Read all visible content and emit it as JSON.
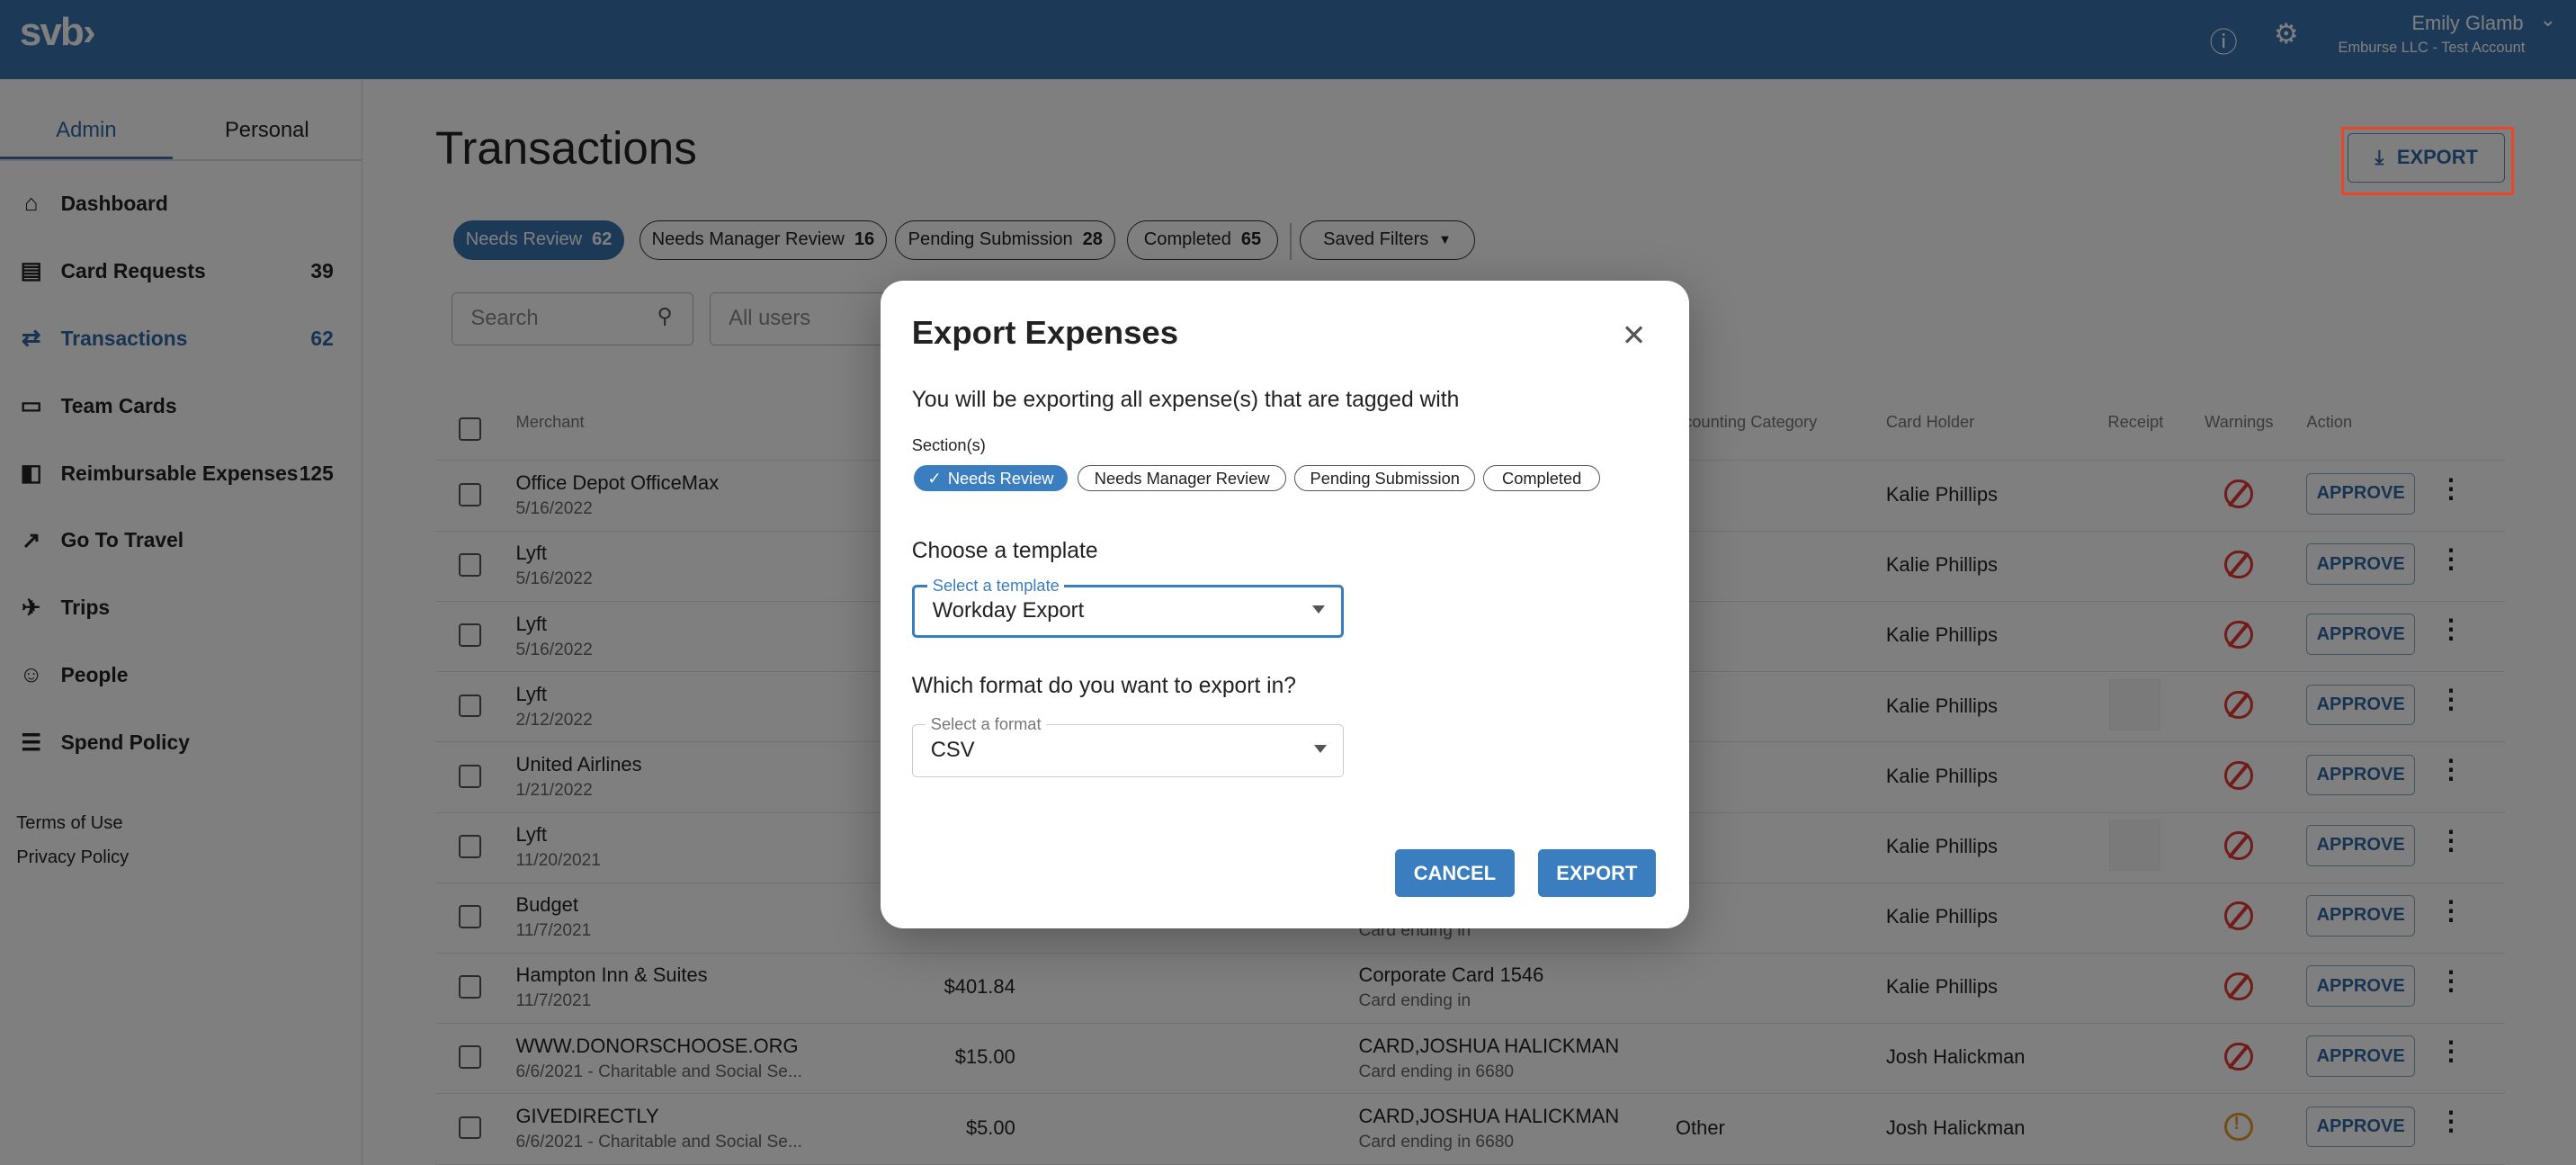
{
  "header": {
    "logo": "svb›",
    "help_icon": "help-circle-icon",
    "settings_icon": "gear-icon",
    "user_name": "Emily Glamb",
    "account": "Emburse LLC - Test Account"
  },
  "sidebar": {
    "tabs": [
      "Admin",
      "Personal"
    ],
    "active_tab": "Admin",
    "items": [
      {
        "label": "Dashboard",
        "count": "",
        "icon": "⌂"
      },
      {
        "label": "Card Requests",
        "count": "39",
        "icon": "▤"
      },
      {
        "label": "Transactions",
        "count": "62",
        "icon": "⇄",
        "active": true
      },
      {
        "label": "Team Cards",
        "count": "",
        "icon": "▭"
      },
      {
        "label": "Reimbursable Expenses",
        "count": "125",
        "icon": "◧"
      },
      {
        "label": "Go To Travel",
        "count": "",
        "icon": "↗"
      },
      {
        "label": "Trips",
        "count": "",
        "icon": "✈"
      },
      {
        "label": "People",
        "count": "",
        "icon": "☺"
      },
      {
        "label": "Spend Policy",
        "count": "",
        "icon": "☰"
      }
    ],
    "links": [
      "Terms of Use",
      "Privacy Policy"
    ]
  },
  "page": {
    "title": "Transactions",
    "export_label": "EXPORT",
    "filters": [
      {
        "label": "Needs Review",
        "count": "62",
        "active": true
      },
      {
        "label": "Needs Manager Review",
        "count": "16"
      },
      {
        "label": "Pending Submission",
        "count": "28"
      },
      {
        "label": "Completed",
        "count": "65"
      }
    ],
    "saved_filters": "Saved Filters",
    "search_placeholder": "Search",
    "users_filter": "All users"
  },
  "table": {
    "headers": {
      "merchant": "Merchant",
      "accounting": "ccounting Category",
      "holder": "Card Holder",
      "receipt": "Receipt",
      "warnings": "Warnings",
      "action": "Action"
    },
    "approve_label": "APPROVE",
    "rows": [
      {
        "merchant": "Office Depot OfficeMax",
        "sub": "5/16/2022",
        "amount": "",
        "card": "",
        "card_sub": "",
        "accounting": "",
        "holder": "Kalie Phillips",
        "receipt": false,
        "warning": "blocked"
      },
      {
        "merchant": "Lyft",
        "sub": "5/16/2022",
        "amount": "",
        "card": "",
        "card_sub": "",
        "accounting": "",
        "holder": "Kalie Phillips",
        "receipt": false,
        "warning": "blocked"
      },
      {
        "merchant": "Lyft",
        "sub": "5/16/2022",
        "amount": "",
        "card": "",
        "card_sub": "",
        "accounting": "",
        "holder": "Kalie Phillips",
        "receipt": false,
        "warning": "blocked"
      },
      {
        "merchant": "Lyft",
        "sub": "2/12/2022",
        "amount": "",
        "card": "",
        "card_sub": "",
        "accounting": "",
        "holder": "Kalie Phillips",
        "receipt": true,
        "warning": "blocked"
      },
      {
        "merchant": "United Airlines",
        "sub": "1/21/2022",
        "amount": "",
        "card": "",
        "card_sub": "",
        "accounting": "",
        "holder": "Kalie Phillips",
        "receipt": false,
        "warning": "blocked"
      },
      {
        "merchant": "Lyft",
        "sub": "11/20/2021",
        "amount": "",
        "card": "",
        "card_sub": "",
        "accounting": "",
        "holder": "Kalie Phillips",
        "receipt": true,
        "warning": "blocked"
      },
      {
        "merchant": "Budget",
        "sub": "11/7/2021",
        "amount": "",
        "card": "",
        "card_sub": "Card ending in",
        "accounting": "",
        "holder": "Kalie Phillips",
        "receipt": false,
        "warning": "blocked"
      },
      {
        "merchant": "Hampton Inn & Suites",
        "sub": "11/7/2021",
        "amount": "$401.84",
        "card": "Corporate Card 1546",
        "card_sub": "Card ending in",
        "accounting": "",
        "holder": "Kalie Phillips",
        "receipt": false,
        "warning": "blocked"
      },
      {
        "merchant": "WWW.DONORSCHOOSE.ORG",
        "sub": "6/6/2021 - Charitable and Social Se...",
        "amount": "$15.00",
        "card": "CARD,JOSHUA HALICKMAN",
        "card_sub": "Card ending in 6680",
        "accounting": "",
        "holder": "Josh Halickman",
        "receipt": false,
        "warning": "blocked"
      },
      {
        "merchant": "GIVEDIRECTLY",
        "sub": "6/6/2021 - Charitable and Social Se...",
        "amount": "$5.00",
        "card": "CARD,JOSHUA HALICKMAN",
        "card_sub": "Card ending in 6680",
        "accounting": "Other",
        "holder": "Josh Halickman",
        "receipt": false,
        "warning": "alert"
      }
    ]
  },
  "dialog": {
    "title": "Export Expenses",
    "intro": "You will be exporting all expense(s) that are tagged with",
    "sections_label": "Section(s)",
    "sections": [
      {
        "label": "Needs Review",
        "selected": true
      },
      {
        "label": "Needs Manager Review",
        "selected": false
      },
      {
        "label": "Pending Submission",
        "selected": false
      },
      {
        "label": "Completed",
        "selected": false
      }
    ],
    "template_heading": "Choose a template",
    "template_label": "Select a template",
    "template_value": "Workday Export",
    "format_heading": "Which format do you want to export in?",
    "format_label": "Select a format",
    "format_value": "CSV",
    "cancel": "CANCEL",
    "export": "EXPORT"
  },
  "colors": {
    "brand": "#3874ae",
    "button": "#3a7ebf",
    "highlight": "#e8472a",
    "blocked": "#e53935",
    "alert": "#e89a2c"
  }
}
